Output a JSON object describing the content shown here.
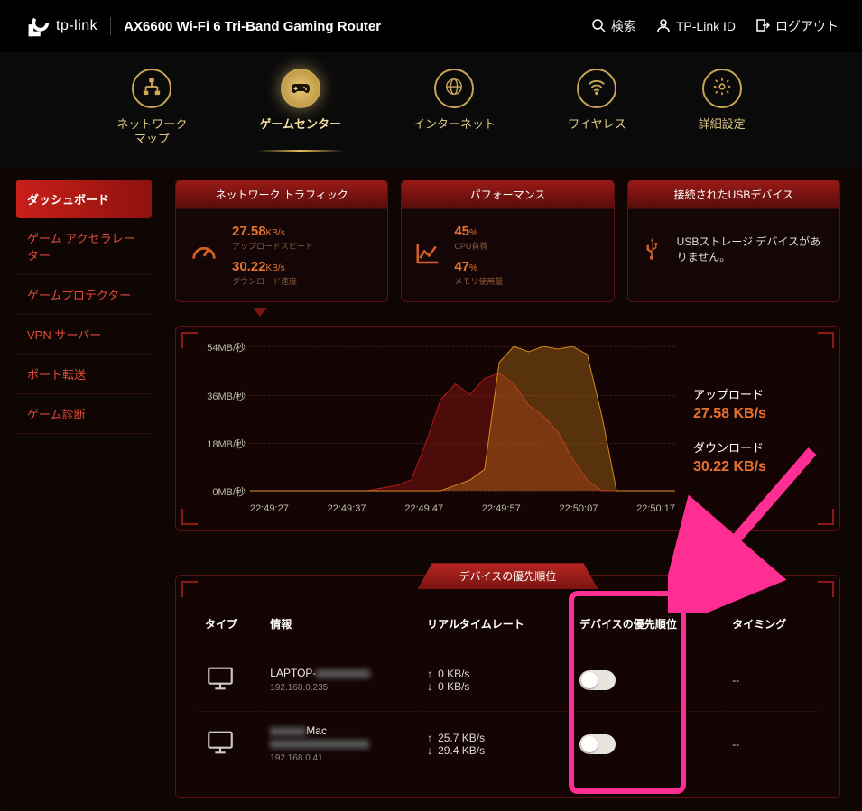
{
  "header": {
    "brand": "tp-link",
    "product": "AX6600 Wi-Fi 6 Tri-Band Gaming Router",
    "search": "検索",
    "tplink_id": "TP-Link ID",
    "logout": "ログアウト"
  },
  "nav": {
    "network_map": "ネットワーク\nマップ",
    "game_center": "ゲームセンター",
    "internet": "インターネット",
    "wireless": "ワイヤレス",
    "advanced": "詳細設定"
  },
  "sidebar": {
    "dashboard": "ダッシュボード",
    "game_accel": "ゲーム アクセラレーター",
    "game_protector": "ゲームプロテクター",
    "vpn_server": "VPN サーバー",
    "port_fwd": "ポート転送",
    "game_diag": "ゲーム診断"
  },
  "cards": {
    "traffic": {
      "title": "ネットワーク トラフィック",
      "up_val": "27.58",
      "up_unit": "KB/s",
      "up_label": "アップロードスピード",
      "down_val": "30.22",
      "down_unit": "KB/s",
      "down_label": "ダウンロード速度"
    },
    "performance": {
      "title": "パフォーマンス",
      "cpu_val": "45",
      "cpu_unit": "%",
      "cpu_label": "CPU負荷",
      "mem_val": "47",
      "mem_unit": "%",
      "mem_label": "メモリ使用量"
    },
    "usb": {
      "title": "接続されたUSBデバイス",
      "message": "USBストレージ デバイスがありません。"
    }
  },
  "chart_data": {
    "type": "area",
    "ylim": [
      0,
      54
    ],
    "ylabel_unit": "MB/秒",
    "yticks": [
      "54MB/秒",
      "36MB/秒",
      "18MB/秒",
      "0MB/秒"
    ],
    "xticks": [
      "22:49:27",
      "22:49:37",
      "22:49:47",
      "22:49:57",
      "22:50:07",
      "22:50:17"
    ],
    "series": [
      {
        "name": "アップロード",
        "color": "#b31c17",
        "values": [
          0,
          0,
          0,
          0,
          0,
          0,
          0,
          0,
          0,
          1,
          2,
          4,
          18,
          34,
          40,
          36,
          42,
          44,
          40,
          32,
          28,
          22,
          12,
          4,
          0,
          0,
          0,
          0,
          0,
          0
        ]
      },
      {
        "name": "ダウンロード",
        "color": "#d48a1e",
        "values": [
          0,
          0,
          0,
          0,
          0,
          0,
          0,
          0,
          0,
          0,
          0,
          0,
          0,
          0,
          2,
          4,
          8,
          48,
          54,
          52,
          54,
          53,
          54,
          51,
          28,
          0,
          0,
          0,
          0,
          0
        ]
      }
    ],
    "legend": {
      "upload_label": "アップロード",
      "upload_val": "27.58 KB/s",
      "download_label": "ダウンロード",
      "download_val": "30.22 KB/s"
    }
  },
  "priority": {
    "title": "デバイスの優先順位",
    "columns": {
      "type": "タイプ",
      "info": "情報",
      "rate": "リアルタイムレート",
      "priority": "デバイスの優先順位",
      "timing": "タイミング"
    },
    "devices": [
      {
        "name_prefix": "LAPTOP-",
        "ip": "192.168.0.235",
        "up": "0 KB/s",
        "down": "0 KB/s",
        "timing": "--"
      },
      {
        "name_suffix": "Mac",
        "ip": "192.168.0.41",
        "up": "25.7 KB/s",
        "down": "29.4 KB/s",
        "timing": "--"
      }
    ]
  }
}
